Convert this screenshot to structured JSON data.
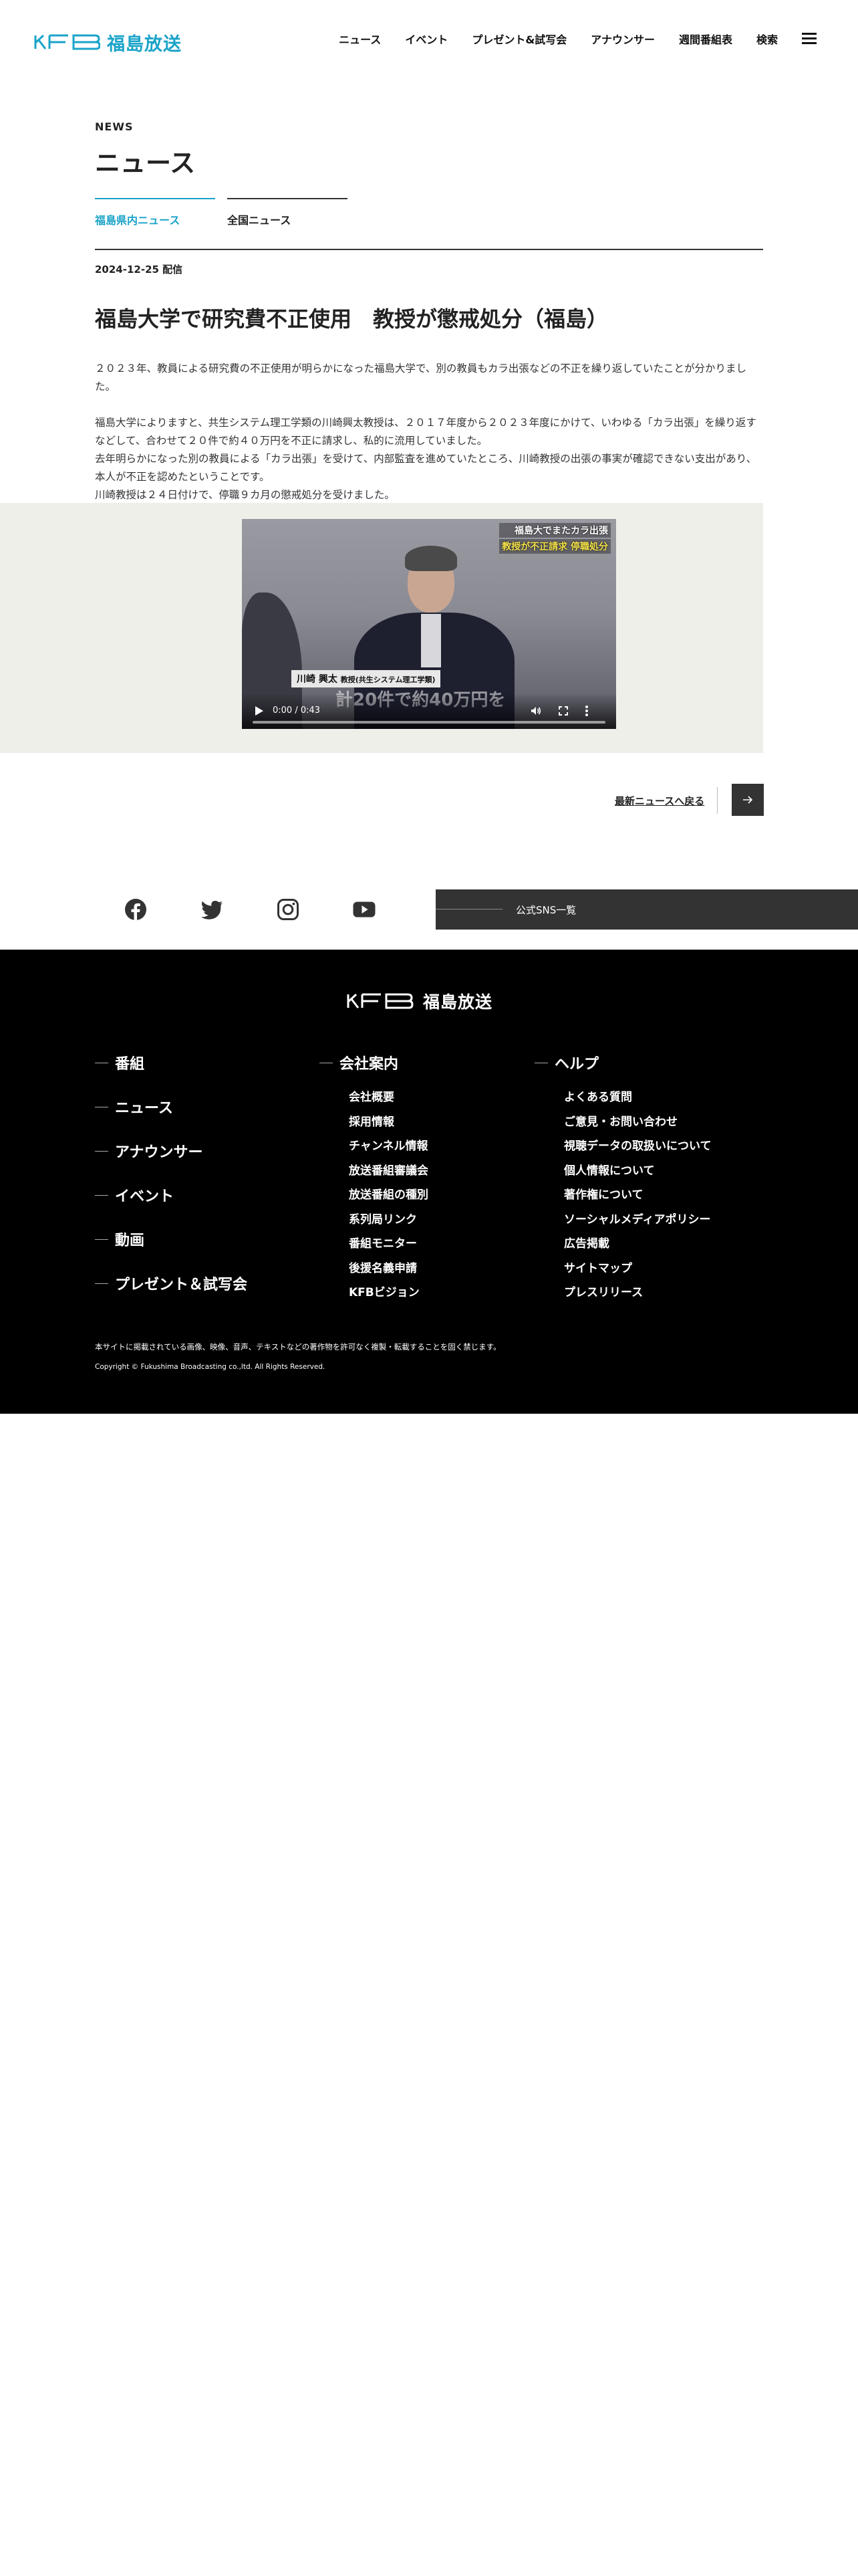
{
  "header": {
    "logo_text": "福島放送",
    "nav": [
      "ニュース",
      "イベント",
      "プレゼント&試写会",
      "アナウンサー",
      "週間番組表",
      "検索"
    ]
  },
  "section": {
    "label_en": "NEWS",
    "title": "ニュース"
  },
  "tabs": [
    {
      "label": "福島県内ニュース",
      "active": true
    },
    {
      "label": "全国ニュース",
      "active": false
    }
  ],
  "article": {
    "date": "2024-12-25 配信",
    "title": "福島大学で研究費不正使用　教授が懲戒処分（福島）",
    "paragraphs": [
      "２０２３年、教員による研究費の不正使用が明らかになった福島大学で、別の教員もカラ出張などの不正を繰り返していたことが分かりました。",
      "福島大学によりますと、共生システム理工学類の川崎興太教授は、２０１７年度から２０２３年度にかけて、いわゆる「カラ出張」を繰り返すなどして、合わせて２０件で約４０万円を不正に請求し、私的に流用していました。\n去年明らかになった別の教員による「カラ出張」を受けて、内部監査を進めていたところ、川崎教授の出張の事実が確認できない支出があり、本人が不正を認めたということです。\n川崎教授は２４日付けで、停職９カ月の懲戒処分を受けました。"
    ]
  },
  "video": {
    "caption_line1": "福島大でまたカラ出張",
    "caption_line2": "教授が不正請求 停職処分",
    "name_strip": "川崎 興太",
    "name_role": "教授(共生システム理工学類)",
    "subtitle": "計20件で約40万円を",
    "time": "0:00 / 0:43",
    "progress": 0
  },
  "back": {
    "label": "最新ニュースへ戻る"
  },
  "sns": {
    "icons": [
      "facebook-icon",
      "twitter-icon",
      "instagram-icon",
      "youtube-icon"
    ],
    "list_label": "公式SNS一覧"
  },
  "footer": {
    "logo_text": "福島放送",
    "col1": [
      "番組",
      "ニュース",
      "アナウンサー",
      "イベント",
      "動画",
      "プレゼント＆試写会"
    ],
    "col2": {
      "heading": "会社案内",
      "items": [
        "会社概要",
        "採用情報",
        "チャンネル情報",
        "放送番組審議会",
        "放送番組の種別",
        "系列局リンク",
        "番組モニター",
        "後援名義申請",
        "KFBビジョン"
      ]
    },
    "col3": {
      "heading": "ヘルプ",
      "items": [
        "よくある質問",
        "ご意見・お問い合わせ",
        "視聴データの取扱いについて",
        "個人情報について",
        "著作権について",
        "ソーシャルメディアポリシー",
        "広告掲載",
        "サイトマップ",
        "プレスリリース"
      ]
    },
    "notice": "本サイトに掲載されている画像、映像、音声、テキストなどの著作物を許可なく複製・転載することを固く禁じます。",
    "copyright": "Copyright © Fukushima Broadcasting co.,ltd. All Rights Reserved."
  },
  "colors": {
    "brand": "#1aa3c9",
    "footer_bg": "#000000",
    "video_band": "#efefea",
    "dark_button": "#333333"
  }
}
